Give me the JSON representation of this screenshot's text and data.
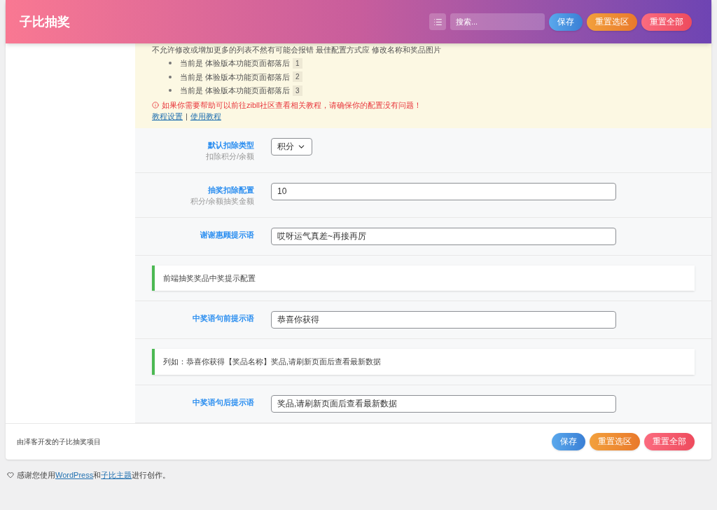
{
  "header": {
    "title": "子比抽奖",
    "search": {
      "placeholder": "搜索..."
    },
    "buttons": [
      {
        "label": "保存",
        "kind": "save"
      },
      {
        "label": "重置选区",
        "kind": "reset-section"
      },
      {
        "label": "重置全部",
        "kind": "reset-all"
      }
    ]
  },
  "notice": {
    "intro": "不允许修改或增加更多的列表不然有可能会报错 最佳配置方式应 修改名称和奖品图片",
    "items": [
      {
        "text": "当前是 体验版本功能页面都落后",
        "badge": "1"
      },
      {
        "text": "当前是 体验版本功能页面都落后",
        "badge": "2"
      },
      {
        "text": "当前是 体验版本功能页面都落后",
        "badge": "3"
      }
    ],
    "warning": "如果你需要帮助可以前往zibll社区查看相关教程，请确保你的配置没有问题！",
    "links": [
      "教程设置",
      "使用教程"
    ],
    "separator": "|"
  },
  "rows": [
    {
      "kind": "select",
      "label": "默认扣除类型",
      "subtitle": "扣除积分/余额",
      "value": "积分"
    },
    {
      "kind": "input",
      "label": "抽奖扣除配置",
      "subtitle": "积分/余额抽奖金额",
      "value": "10"
    },
    {
      "kind": "input",
      "label": "谢谢惠顾提示语",
      "value": "哎呀运气真差~再接再厉"
    },
    {
      "kind": "note",
      "text": "前端抽奖奖品中奖提示配置"
    },
    {
      "kind": "input",
      "label": "中奖语句前提示语",
      "value": "恭喜你获得"
    },
    {
      "kind": "note",
      "text": "列如：恭喜你获得【奖品名称】奖品,请刷新页面后查看最新数据"
    },
    {
      "kind": "input",
      "label": "中奖语句后提示语",
      "value": "奖品,请刷新页面后查看最新数据"
    }
  ],
  "footer": {
    "text": "由泽客开发的子比抽奖项目",
    "buttons": [
      {
        "label": "保存",
        "kind": "save"
      },
      {
        "label": "重置选区",
        "kind": "reset-section"
      },
      {
        "label": "重置全部",
        "kind": "reset-all"
      }
    ]
  },
  "credit": {
    "before": "感谢您使用",
    "link1": "WordPress",
    "middle": "和",
    "link2": "子比主题",
    "after": "进行创作。"
  }
}
